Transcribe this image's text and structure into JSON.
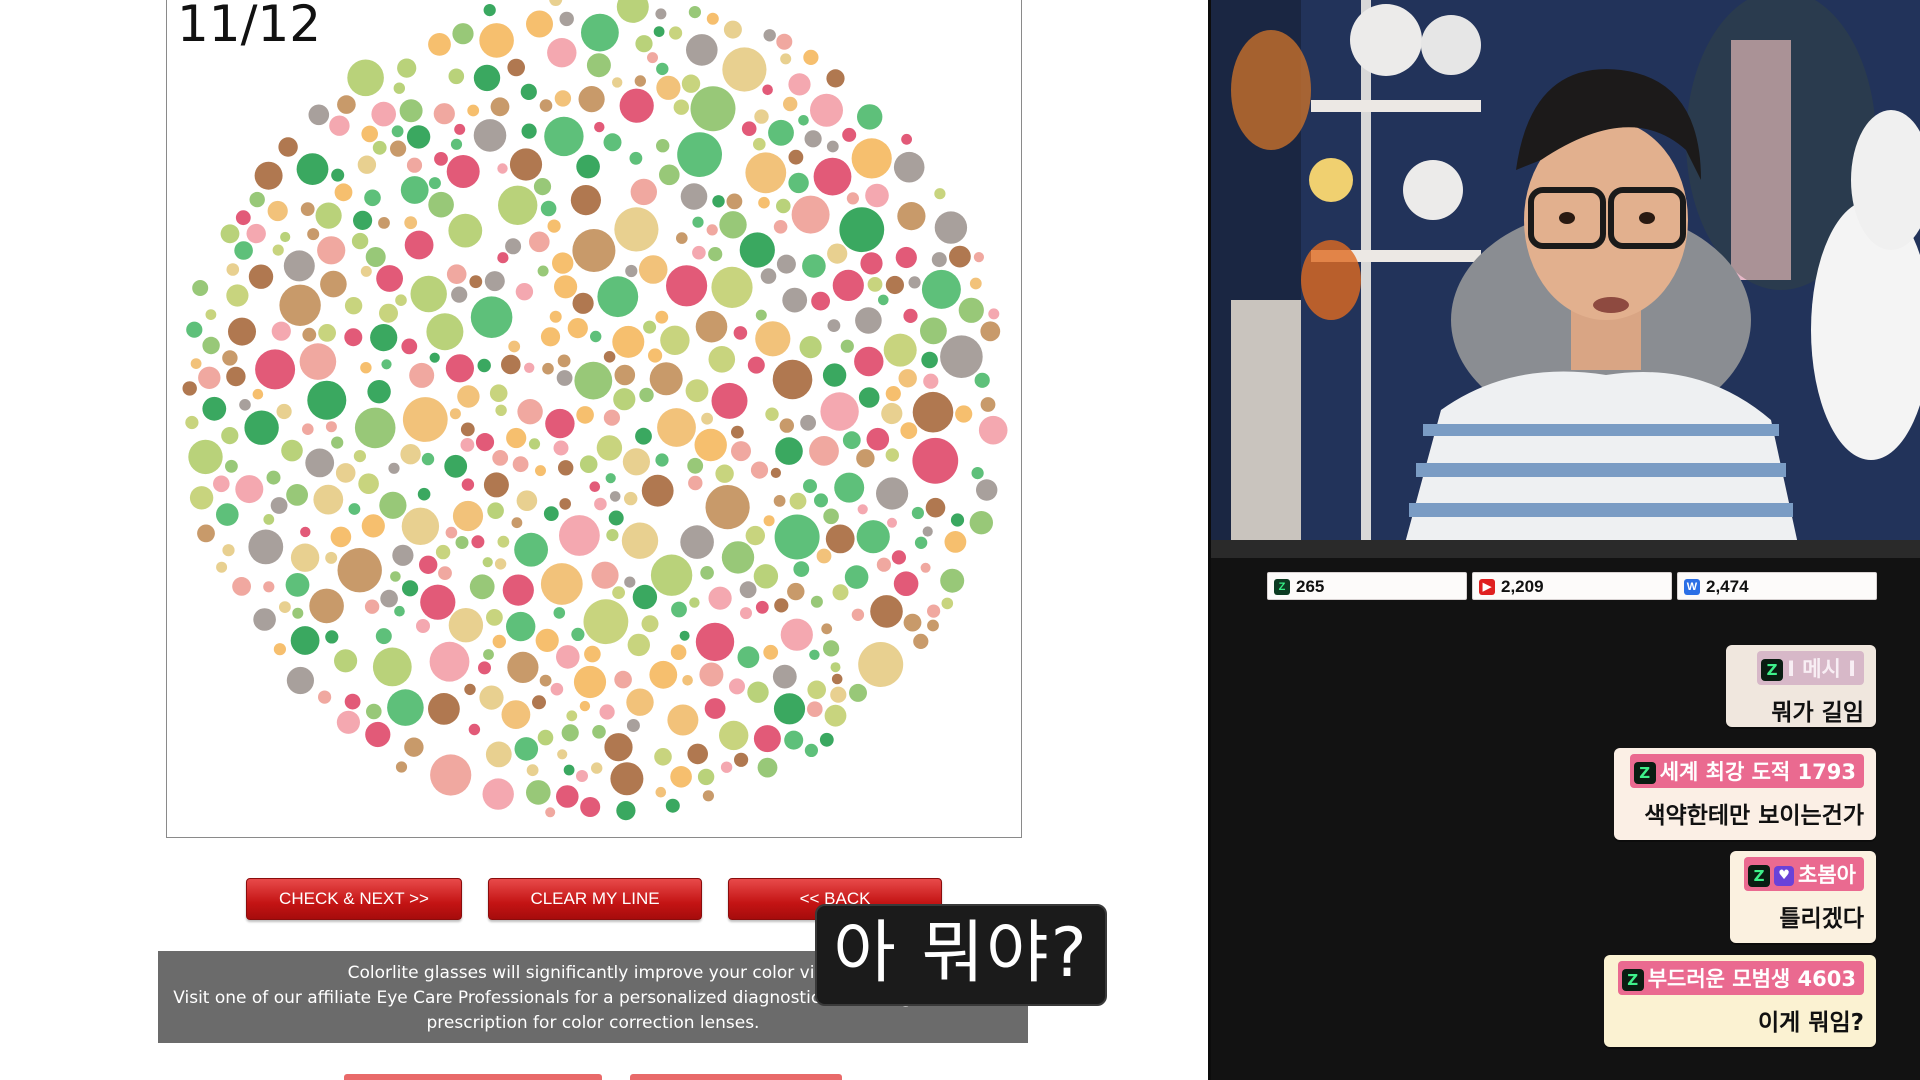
{
  "test": {
    "progress": "11/12",
    "buttons": {
      "check_next": "CHECK & NEXT >>",
      "clear_line": "CLEAR MY LINE",
      "back": "<< BACK"
    },
    "promo": {
      "line1": "Colorlite glasses will significantly improve your color visio",
      "line2": "Visit one of our affiliate Eye Care Professionals for a personalized diagnostic test and get a custom",
      "line3": "prescription for color correction lenses."
    }
  },
  "subtitle": "아 뭐야?",
  "stats": [
    {
      "platform": "chzzk",
      "icon": "Z",
      "count": "265",
      "color": "#0c3b22"
    },
    {
      "platform": "youtube",
      "icon": "▶",
      "count": "2,209",
      "color": "#e02020"
    },
    {
      "platform": "afreeca",
      "icon": "W",
      "count": "2,474",
      "color": "#2b6fe6"
    }
  ],
  "chat": [
    {
      "name": "I 메시 I",
      "message": "뭐가 길임"
    },
    {
      "name": "세계 최강 도적 1793",
      "message": "색약한테만 보이는건가"
    },
    {
      "name": "초봄아",
      "message": "틀리겠다"
    },
    {
      "name": "부드러운 모범생 4603",
      "message": "이게 뭐임?"
    }
  ],
  "plate_colors": [
    "#f6bf6e",
    "#f2c27a",
    "#c8d47e",
    "#b9d27a",
    "#f0a8a0",
    "#e25a78",
    "#5ec07a",
    "#3aa860",
    "#a8a09c",
    "#b07850",
    "#c89a6a",
    "#e8d090",
    "#98c878",
    "#f4a8b0"
  ]
}
